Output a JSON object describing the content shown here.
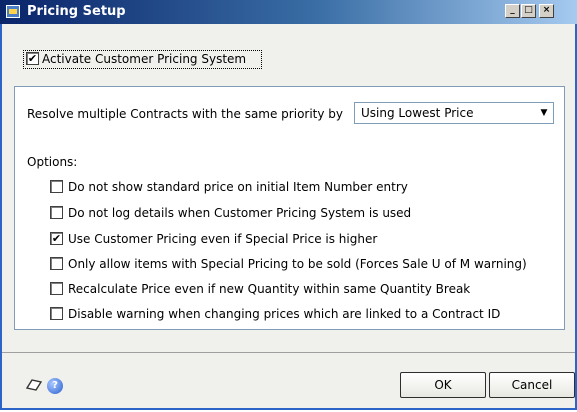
{
  "window": {
    "title": "Pricing Setup",
    "minimize_glyph": "_",
    "maximize_glyph": "□",
    "close_glyph": "×"
  },
  "activate": {
    "label": "Activate Customer Pricing System",
    "checked": true
  },
  "resolve": {
    "label": "Resolve multiple Contracts with the same priority by",
    "selected": "Using Lowest Price"
  },
  "options": {
    "heading": "Options:",
    "items": [
      {
        "label": "Do not show standard price on initial Item Number entry",
        "checked": false
      },
      {
        "label": "Do not log details when Customer Pricing System is used",
        "checked": false
      },
      {
        "label": "Use Customer Pricing even if Special Price is higher",
        "checked": true
      },
      {
        "label": "Only allow items with Special Pricing to be sold (Forces Sale U of M warning)",
        "checked": false
      },
      {
        "label": "Recalculate Price even if new Quantity within same Quantity Break",
        "checked": false
      },
      {
        "label": "Disable warning when changing prices which are linked to a Contract ID",
        "checked": false
      }
    ]
  },
  "footer": {
    "note_icon": "note-icon",
    "help_icon": "help-icon",
    "ok_label": "OK",
    "cancel_label": "Cancel"
  }
}
